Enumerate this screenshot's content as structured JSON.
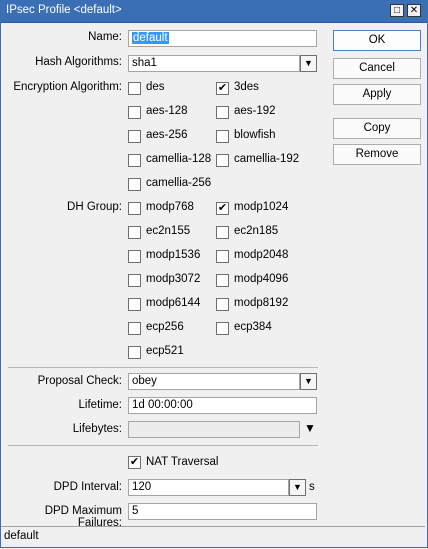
{
  "window": {
    "title": "IPsec Profile <default>",
    "restore_glyph": "□",
    "close_glyph": "✕"
  },
  "fields": {
    "name": {
      "label": "Name:",
      "value": "default"
    },
    "hash": {
      "label": "Hash Algorithms:",
      "value": "sha1"
    },
    "enc": {
      "label": "Encryption Algorithm:"
    },
    "dh": {
      "label": "DH Group:"
    },
    "proposal": {
      "label": "Proposal Check:",
      "value": "obey"
    },
    "lifetime": {
      "label": "Lifetime:",
      "value": "1d 00:00:00"
    },
    "lifebytes": {
      "label": "Lifebytes:",
      "value": ""
    },
    "nat": {
      "label": "NAT Traversal",
      "checked": true
    },
    "dpd_interval": {
      "label": "DPD Interval:",
      "value": "120",
      "unit": "s"
    },
    "dpd_max": {
      "label": "DPD Maximum Failures:",
      "value": "5"
    }
  },
  "encryption": [
    {
      "label": "des",
      "checked": false
    },
    {
      "label": "3des",
      "checked": true
    },
    {
      "label": "aes-128",
      "checked": false
    },
    {
      "label": "aes-192",
      "checked": false
    },
    {
      "label": "aes-256",
      "checked": false
    },
    {
      "label": "blowfish",
      "checked": false
    },
    {
      "label": "camellia-128",
      "checked": false
    },
    {
      "label": "camellia-192",
      "checked": false
    },
    {
      "label": "camellia-256",
      "checked": false
    }
  ],
  "dh_groups": [
    {
      "label": "modp768",
      "checked": false
    },
    {
      "label": "modp1024",
      "checked": true
    },
    {
      "label": "ec2n155",
      "checked": false
    },
    {
      "label": "ec2n185",
      "checked": false
    },
    {
      "label": "modp1536",
      "checked": false
    },
    {
      "label": "modp2048",
      "checked": false
    },
    {
      "label": "modp3072",
      "checked": false
    },
    {
      "label": "modp4096",
      "checked": false
    },
    {
      "label": "modp6144",
      "checked": false
    },
    {
      "label": "modp8192",
      "checked": false
    },
    {
      "label": "ecp256",
      "checked": false
    },
    {
      "label": "ecp384",
      "checked": false
    },
    {
      "label": "ecp521",
      "checked": false
    }
  ],
  "buttons": {
    "ok": "OK",
    "cancel": "Cancel",
    "apply": "Apply",
    "copy": "Copy",
    "remove": "Remove"
  },
  "status": {
    "text": "default"
  },
  "icons": {
    "dropdown": "dropdown-arrow-icon",
    "check": "✔"
  }
}
